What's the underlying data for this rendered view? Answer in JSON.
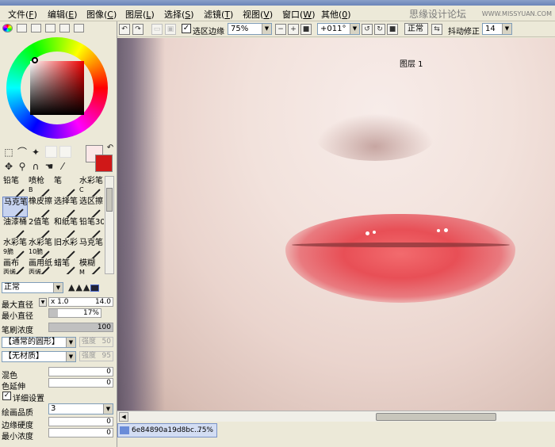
{
  "menu": {
    "items": [
      {
        "label": "文件",
        "key": "F"
      },
      {
        "label": "编辑",
        "key": "E"
      },
      {
        "label": "图像",
        "key": "C"
      },
      {
        "label": "图层",
        "key": "L"
      },
      {
        "label": "选择",
        "key": "S"
      },
      {
        "label": "滤镜",
        "key": "T"
      },
      {
        "label": "视图",
        "key": "V"
      },
      {
        "label": "窗口",
        "key": "W"
      },
      {
        "label": "其他",
        "key": "0"
      }
    ],
    "watermark": "思缘设计论坛",
    "watermark_url": "WWW.MISSYUAN.COM"
  },
  "toolbar": {
    "selection_edge_label": "选区边缘",
    "selection_edge_checked": true,
    "zoom": "75%",
    "rotation": "+011°",
    "blend_mode": "正常",
    "stabilizer_label": "抖动修正",
    "stabilizer_value": "14"
  },
  "brushes": [
    {
      "name": "铅笔",
      "key": ""
    },
    {
      "name": "喷枪",
      "key": "B"
    },
    {
      "name": "笔",
      "key": ""
    },
    {
      "name": "水彩笔",
      "key": "C"
    },
    {
      "name": "马克笔",
      "key": ""
    },
    {
      "name": "橡皮擦",
      "key": ""
    },
    {
      "name": "选择笔",
      "key": ""
    },
    {
      "name": "选区擦",
      "key": ""
    },
    {
      "name": "油漆桶",
      "key": ""
    },
    {
      "name": "2值笔",
      "key": ""
    },
    {
      "name": "和纸笔",
      "key": ""
    },
    {
      "name": "铅笔30",
      "key": ""
    },
    {
      "name": "水彩笔",
      "key": "9脆"
    },
    {
      "name": "水彩笔",
      "key": "10脆"
    },
    {
      "name": "旧水彩",
      "key": ""
    },
    {
      "name": "马克笔",
      "key": ""
    },
    {
      "name": "画布",
      "key": "丙烯"
    },
    {
      "name": "画用纸",
      "key": "丙烯"
    },
    {
      "name": "蜡笔",
      "key": ""
    },
    {
      "name": "模糊",
      "key": "M"
    }
  ],
  "brush_panel": {
    "blend_mode": "正常",
    "max_diameter_label": "最大直径",
    "max_diameter_scale": "x 1.0",
    "max_diameter_value": "14.0",
    "min_diameter_label": "最小直径",
    "min_diameter_value": "17%",
    "min_diameter_fraction": 0.17,
    "density_label": "笔刷浓度",
    "density_value": "100",
    "density_fraction": 1.0,
    "shape_select": "【通常的圆形】",
    "shape_strength_label": "强度",
    "shape_strength_value": "50",
    "texture_select": "【无材质】",
    "texture_strength_label": "强度",
    "texture_strength_value": "95",
    "mix_label": "混色",
    "mix_value": "0",
    "extend_label": "色延伸",
    "extend_value": "0",
    "detail_label": "详细设置",
    "detail_checked": true,
    "quality_label": "绘画品质",
    "quality_value": "3",
    "edge_hardness_label": "边缘硬度",
    "edge_hardness_value": "0",
    "min_density_label": "最小浓度",
    "min_density_value": "0"
  },
  "canvas": {
    "layer_label": "图层 1"
  },
  "document": {
    "name": "6e84890a19d8bc...",
    "zoom": "75%"
  }
}
